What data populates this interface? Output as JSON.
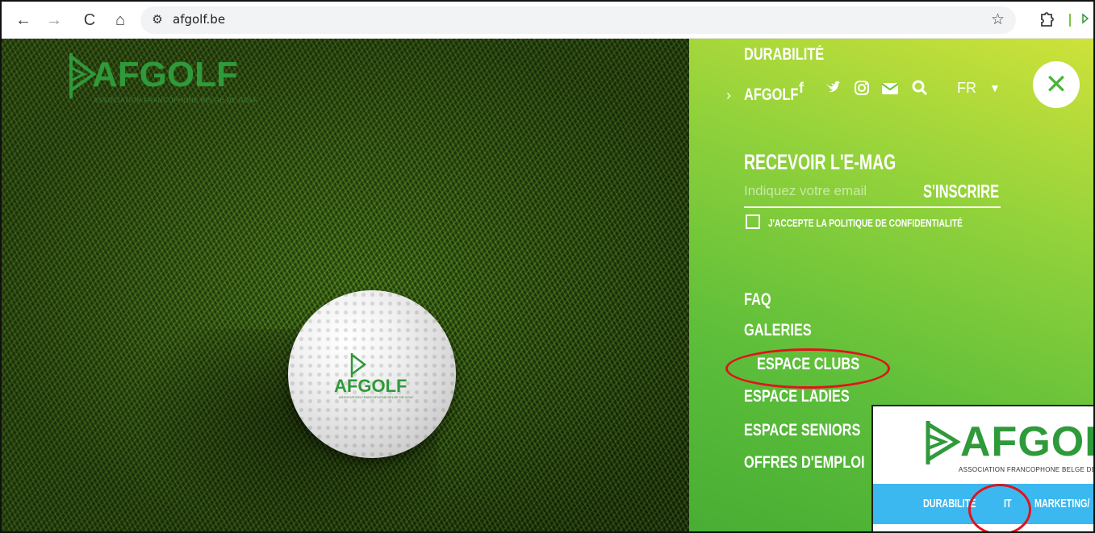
{
  "browser": {
    "url": "afgolf.be",
    "back_glyph": "←",
    "forward_glyph": "→",
    "reload_glyph": "C",
    "home_glyph": "⌂",
    "site_info_glyph": "⚙",
    "star_glyph": "☆"
  },
  "hero": {
    "logo_text": "AFGOLF",
    "logo_subtitle": "ASSOCIATION FRANCOPHONE BELGE DE GOLF",
    "ball_logo_text": "AFGOLF",
    "ball_logo_subtitle": "ASSOCIATION FRANCOPHONE BELGE DE GOLF"
  },
  "menu": {
    "durabilite": "DURABILITÉ",
    "arrow": "›",
    "afgolf": "AFGOLF",
    "social": {
      "facebook": "f",
      "twitter": "🐦",
      "instagram": "◎",
      "mail": "✉",
      "search": "⚲"
    },
    "language": "FR",
    "language_caret": "▼",
    "close_glyph": "✕",
    "emag_title": "RECEVOIR L'E-MAG",
    "email_placeholder": "Indiquez votre email",
    "subscribe_label": "S'INSCRIRE",
    "privacy_label": "J'ACCEPTE LA POLITIQUE DE CONFIDENTIALITÉ",
    "nav": {
      "faq": "FAQ",
      "galeries": "GALERIES",
      "espace_clubs": "ESPACE CLUBS",
      "espace_ladies": "ESPACE LADIES",
      "espace_seniors": "ESPACE SENIORS",
      "offres_emploi": "OFFRES D'EMPLOI"
    }
  },
  "inset": {
    "logo_text": "AFGOLF",
    "subtitle": "ASSOCIATION FRANCOPHONE BELGE DE GOLF",
    "nav": {
      "durabilite": "DURABILITÉ",
      "it": "IT",
      "marketing": "MARKETING/"
    }
  },
  "colors": {
    "brand_green": "#2f9a3a",
    "menu_gradient_top": "#cfe23a",
    "menu_gradient_bottom": "#48ad34",
    "annotation_red": "#e0141b",
    "inset_bar_blue": "#3bb8f0"
  }
}
